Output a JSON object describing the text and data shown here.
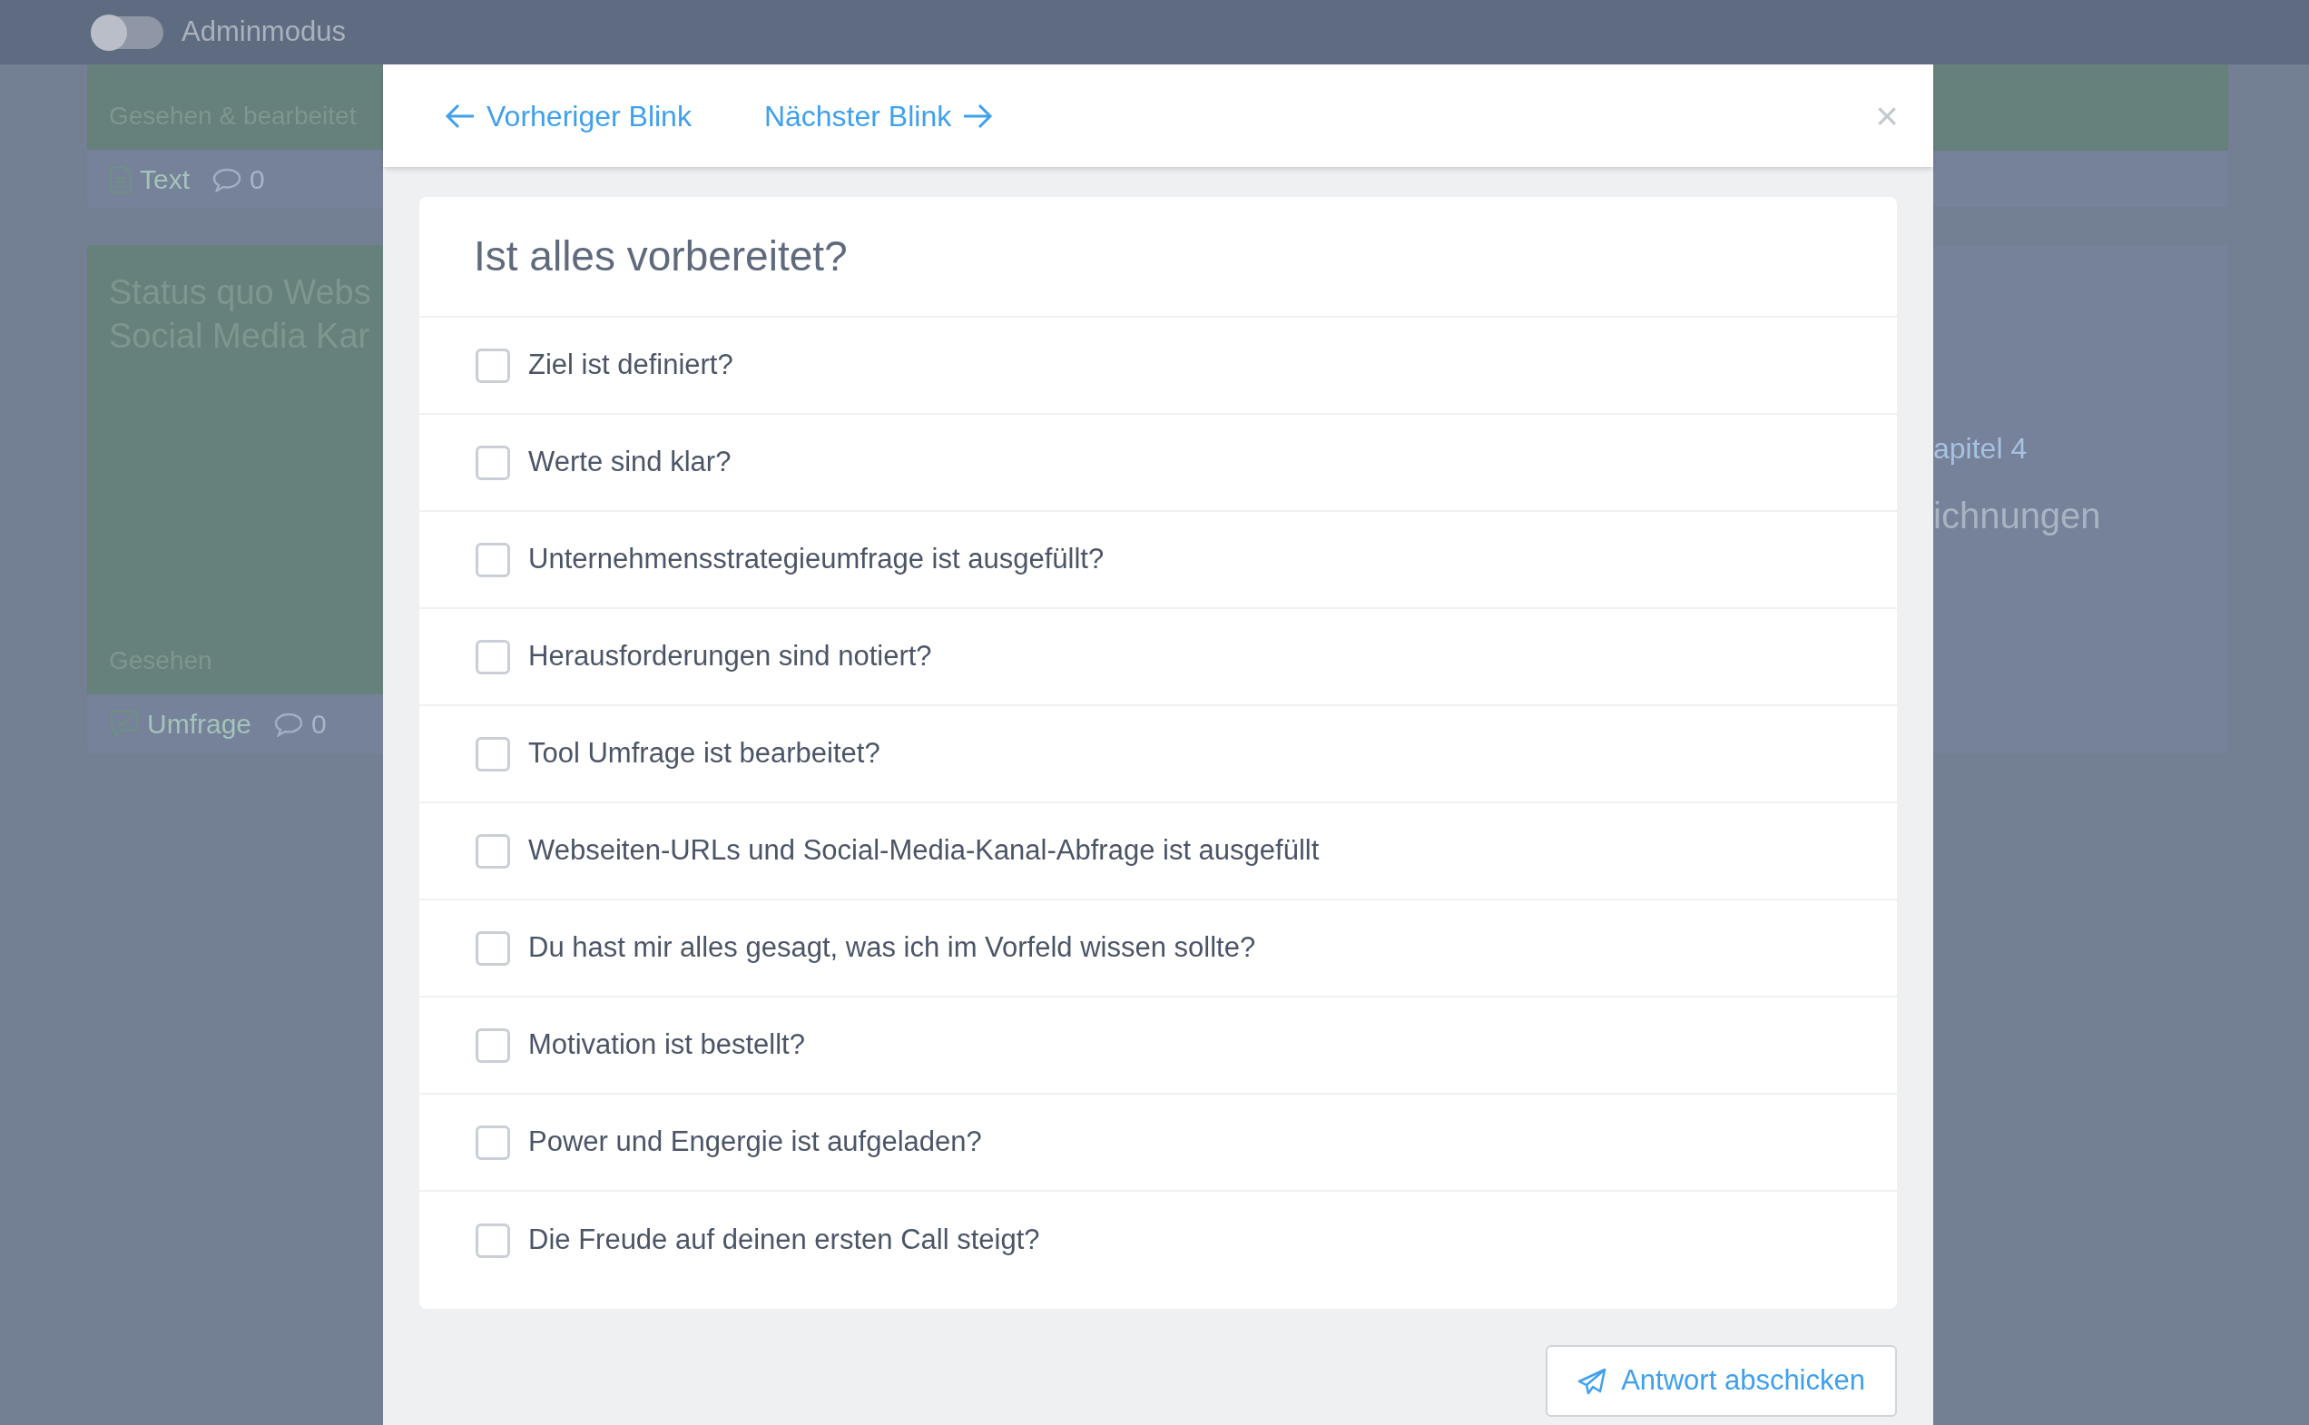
{
  "topbar": {
    "admin_toggle": {
      "label": "Adminmodus",
      "on": false
    }
  },
  "background": {
    "left_cards": [
      {
        "kind": "text",
        "status": "Gesehen & bearbeitet",
        "type_label": "Text",
        "comments": "0"
      },
      {
        "kind": "survey",
        "title_lines": [
          "Status quo Webs",
          "Social Media Kar"
        ],
        "status": "Gesehen",
        "type_label": "Umfrage",
        "comments": "0"
      }
    ],
    "right_card": {
      "chapter": "apitel 4",
      "heading": "ichnungen"
    }
  },
  "modal": {
    "prev": "Vorheriger Blink",
    "next": "Nächster Blink",
    "close": "×",
    "question": "Ist alles vorbereitet?",
    "options": [
      {
        "label": "Ziel ist definiert?",
        "checked": false
      },
      {
        "label": "Werte sind klar?",
        "checked": false
      },
      {
        "label": "Unternehmensstrategieumfrage ist ausgefüllt?",
        "checked": false
      },
      {
        "label": "Herausforderungen sind notiert?",
        "checked": false
      },
      {
        "label": "Tool Umfrage ist bearbeitet?",
        "checked": false
      },
      {
        "label": "Webseiten-URLs und Social-Media-Kanal-Abfrage ist ausgefüllt",
        "checked": false
      },
      {
        "label": "Du hast mir alles gesagt, was ich im Vorfeld wissen sollte?",
        "checked": false
      },
      {
        "label": "Motivation ist bestellt?",
        "checked": false
      },
      {
        "label": "Power und Engergie ist aufgeladen?",
        "checked": false
      },
      {
        "label": "Die Freude auf deinen ersten Call steigt?",
        "checked": false
      }
    ],
    "submit": "Antwort abschicken"
  }
}
